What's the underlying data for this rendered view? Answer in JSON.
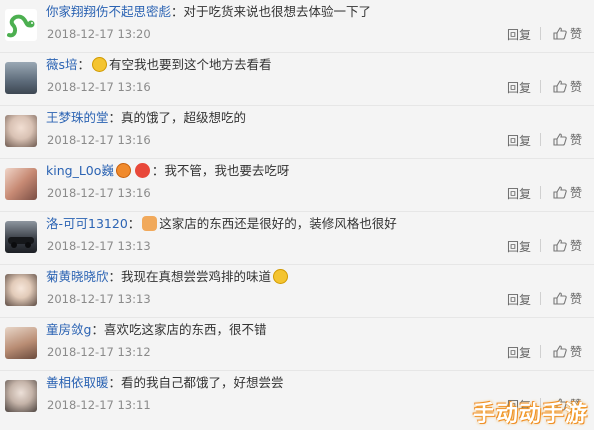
{
  "comments": [
    {
      "user": "你家翔翔伤不起思密彪",
      "text": "对于吃货来说也很想去体验一下了",
      "time": "2018-12-17 13:20",
      "reply": "回复",
      "like": "赞",
      "avatar_color": "#4caf50",
      "avatar": "snake-avatar"
    },
    {
      "user": "薇s培",
      "text": "有空我也要到这个地方去看看",
      "time": "2018-12-17 13:16",
      "reply": "回复",
      "like": "赞",
      "avatar_color": "#5d6b7a",
      "avatar": "photo-avatar",
      "emoji_before": "blush-emoji"
    },
    {
      "user": "王梦珠的堂",
      "text": "真的饿了，超级想吃的",
      "time": "2018-12-17 13:16",
      "reply": "回复",
      "like": "赞",
      "avatar_color": "#d9c2b4",
      "avatar": "photo-avatar"
    },
    {
      "user": "king_L0o巍",
      "text": "我不管，我也要去吃呀",
      "time": "2018-12-17 13:16",
      "reply": "回复",
      "like": "赞",
      "avatar_color": "#c78a74",
      "avatar": "photo-avatar",
      "emoji_before": "angry-emoji"
    },
    {
      "user": "洛-可可13120",
      "text": "这家店的东西还是很好的，装修风格也很好",
      "time": "2018-12-17 13:13",
      "reply": "回复",
      "like": "赞",
      "avatar_color": "#3b4048",
      "avatar": "car-avatar",
      "emoji_before": "cat-emoji"
    },
    {
      "user": "菊黄晓晓欣",
      "text": "我现在真想尝尝鸡排的味道",
      "time": "2018-12-17 13:13",
      "reply": "回复",
      "like": "赞",
      "avatar_color": "#e2cbb9",
      "avatar": "photo-avatar",
      "emoji_after": "laugh-emoji"
    },
    {
      "user": "童房敛g",
      "text": "喜欢吃这家店的东西，很不错",
      "time": "2018-12-17 13:12",
      "reply": "回复",
      "like": "赞",
      "avatar_color": "#b98d74",
      "avatar": "photo-avatar"
    },
    {
      "user": "善相依取暖",
      "text": "看的我自己都饿了，好想尝尝",
      "time": "2018-12-17 13:11",
      "reply": "回复",
      "like": "赞",
      "avatar_color": "#c4b3a8",
      "avatar": "photo-avatar"
    }
  ],
  "watermark": "手动动手游",
  "colors": {
    "username": "#2b63b3",
    "time": "#8a8a8a",
    "background": "#f4f4f4"
  }
}
